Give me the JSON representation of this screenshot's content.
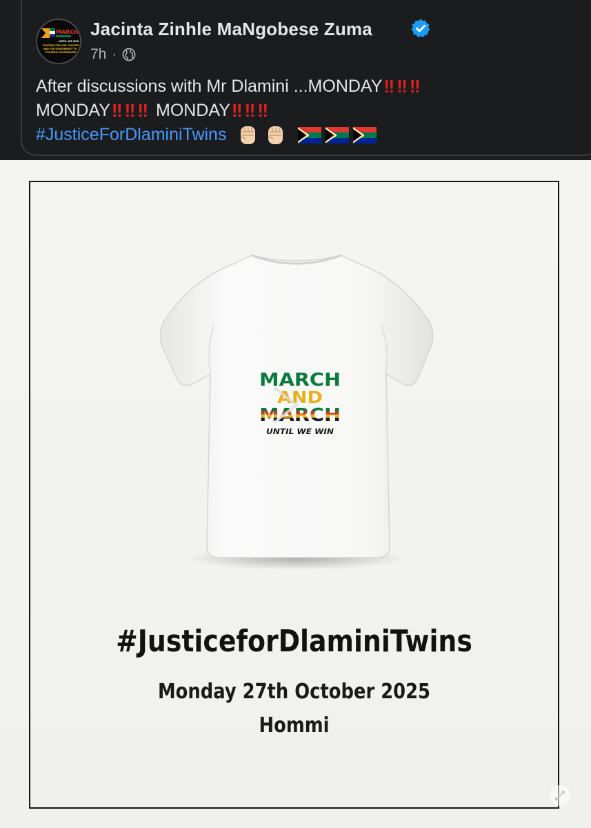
{
  "post": {
    "author_name": "Jacinta Zinhle MaNgobese Zuma",
    "timestamp": "7h",
    "separator": "·",
    "avatar": {
      "top_text": "MARCH",
      "line1": "UNTIL WE WIN",
      "line2": "FIGHTING FOR OUR COUNTRY",
      "line3": "AND FOR GOVERNMENT TO",
      "line4": "PROPERLY GOVERNMENT"
    },
    "text": {
      "line1_text": "After discussions with Mr Dlamini ...MONDAY",
      "line2_monday_1": "MONDAY",
      "line2_monday_2": "MONDAY",
      "bang": "‼",
      "hashtag": "#JusticeForDlaminiTwins"
    },
    "icons": {
      "verified": "verified-badge-icon",
      "audience": "globe-icon",
      "fist": "raised-fist-emoji",
      "flag": "south-africa-flag-emoji"
    }
  },
  "poster": {
    "shirt_print": {
      "line1": "MARCH",
      "line2": "AND",
      "line3": "MARCH",
      "line4": "UNTIL WE WIN"
    },
    "hashtag": "#JusticeforDlaminiTwins",
    "date": "Monday 27th October 2025",
    "venue": "Hommi"
  },
  "colors": {
    "header_bg": "#1b1c1e",
    "text_primary": "#e4e6eb",
    "text_secondary": "#b0b3b8",
    "hashtag_blue": "#4599ff",
    "verified_blue": "#1d9bf0",
    "bang_red": "#e02020",
    "poster_bg": "#f3f3f1"
  }
}
